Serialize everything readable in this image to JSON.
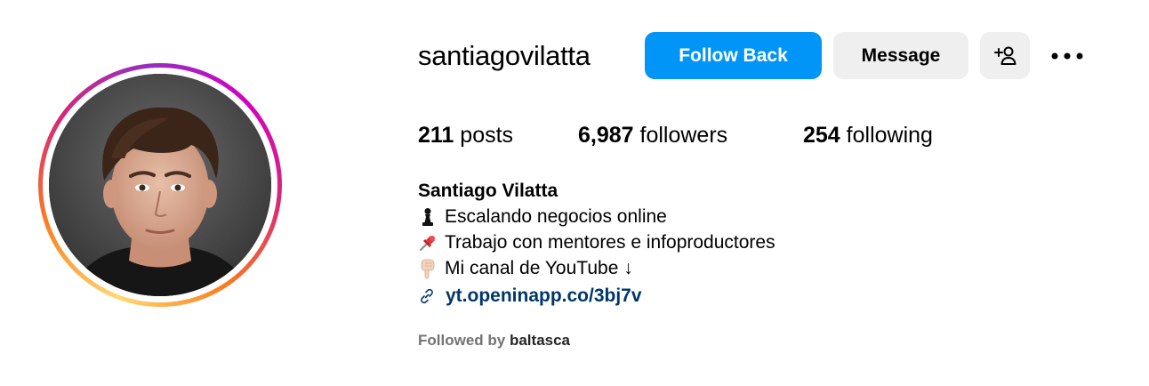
{
  "profile": {
    "username": "santiagovilatta",
    "display_name": "Santiago Vilatta",
    "avatar_icon": "profile-photo"
  },
  "actions": {
    "follow_back_label": "Follow Back",
    "message_label": "Message",
    "add_user_icon": "add-user-icon",
    "more_icon": "more-options-icon"
  },
  "stats": {
    "posts_count": "211",
    "posts_label": "posts",
    "followers_count": "6,987",
    "followers_label": "followers",
    "following_count": "254",
    "following_label": "following"
  },
  "bio": {
    "lines": [
      {
        "icon": "chess-pawn-icon",
        "text": "Escalando negocios online"
      },
      {
        "icon": "pushpin-icon",
        "text": "Trabajo con mentores e infoproductores"
      },
      {
        "icon": "pointing-down-hand-icon",
        "text": "Mi canal de YouTube ↓"
      }
    ],
    "link_icon": "link-icon",
    "link_text": "yt.openinapp.co/3bj7v"
  },
  "followed_by": {
    "prefix": "Followed by",
    "user": "baltasca"
  },
  "colors": {
    "follow_button": "#0095f6",
    "secondary_button": "#efefef",
    "link": "#00376b",
    "muted_text": "#737373"
  }
}
